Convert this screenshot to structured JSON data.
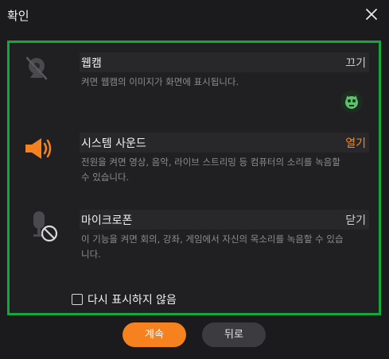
{
  "window": {
    "title": "확인"
  },
  "rows": {
    "webcam": {
      "label": "웹캠",
      "state": "끄기",
      "description": "켜면 웹캠의 이미지가 화면에 표시됩니다."
    },
    "sound": {
      "label": "시스템 사운드",
      "state": "열기",
      "description": "전원을 켜면 영상, 음악, 라이브 스트리밍 등 컴퓨터의 소리를 녹음할 수 있습니다."
    },
    "mic": {
      "label": "마이크로폰",
      "state": "닫기",
      "description": "이 기능을 켜면 회의, 강좌, 게임에서 자신의 목소리를 녹음할 수 있습니다."
    }
  },
  "dont_show": {
    "label": "다시 표시하지 않음"
  },
  "buttons": {
    "continue": "계속",
    "back": "뒤로"
  },
  "colors": {
    "accent": "#f5821f",
    "panel_border": "#14a83c",
    "on_state": "#ff8a1e"
  },
  "icons": [
    "close-icon",
    "webcam-off-icon",
    "speaker-icon",
    "mic-off-icon",
    "avatar-icon"
  ]
}
